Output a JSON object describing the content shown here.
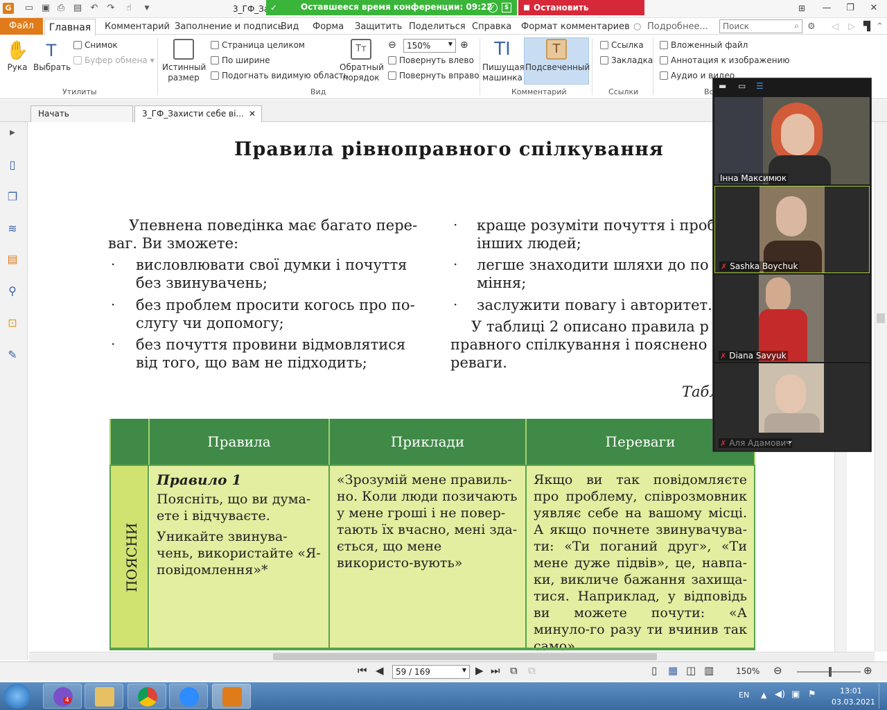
{
  "titlebar": {
    "doc_title": "3_ГФ_За",
    "conference_time": "Оставшееся время конференции: 09:22",
    "stop_demo": "Остановить демонстрацию"
  },
  "menu": {
    "file": "Файл",
    "home": "Главная",
    "items": [
      "Комментарий",
      "Заполнение и подпись",
      "Вид",
      "Форма",
      "Защитить",
      "Поделиться",
      "Справка",
      "Формат комментариев"
    ],
    "details": "Подробнее...",
    "search_placeholder": "Поиск"
  },
  "ribbon": {
    "hand": "Рука",
    "select": "Выбрать",
    "snapshot": "Снимок",
    "clipboard": "Буфер обмена",
    "group_utilities": "Утилиты",
    "actual_size": [
      "Истинный",
      "размер"
    ],
    "full_page": "Страница целиком",
    "fit_width": "По ширине",
    "fit_visible": "Подогнать видимую область",
    "reverse_order": [
      "Обратный",
      "порядок"
    ],
    "zoom": "150%",
    "rotate_left": "Повернуть влево",
    "rotate_right": "Повернуть вправо",
    "group_view": "Вид",
    "typewriter": [
      "Пишущая",
      "машинка"
    ],
    "highlighted": "Подсвеченный",
    "group_comment": "Комментарий",
    "link": "Ссылка",
    "bookmark": "Закладка",
    "group_links": "Ссылки",
    "embedded_file": "Вложенный файл",
    "image_annotation": "Аннотация к изображению",
    "audio_video": "Аудио и видео",
    "group_truncated": "Вс"
  },
  "tabs": {
    "start": "Начать",
    "doc": "3_ГФ_Захисти себе ві..."
  },
  "page": {
    "title": "Правила  рівноправного  спілкування",
    "left_col": {
      "intro1": "Упевнена поведінка має багато пере-",
      "intro2": "ваг. Ви зможете:",
      "b1a": "висловлювати свої думки і почуття",
      "b1b": "без звинувачень;",
      "b2a": "без проблем просити когось про по-",
      "b2b": "слугу чи допомогу;",
      "b3a": "без почуття провини відмовлятися",
      "b3b": "від того, що вам не підходить;"
    },
    "right_col": {
      "b1a": "краще розуміти почуття і проб",
      "b1b": "інших людей;",
      "b2a": "легше знаходити шляхи до по",
      "b2b": "міння;",
      "b3": "заслужити повагу і авторитет.",
      "p1": "У  таблиці  2  описано  правила  р",
      "p2": "правного  спілкування  і  пояснено",
      "p3": "реваги."
    },
    "table_label": "Табл",
    "table": {
      "headers": [
        "Правила",
        "Приклади",
        "Переваги"
      ],
      "side_label": "ПОЯСНИ",
      "rule_title": "Правило 1",
      "rule_text1": "Поясніть, що ви дума-ете і відчуваєте.",
      "rule_text2": "Уникайте звинува-чень, використайте «Я-повідомлення»*",
      "example": "«Зрозумій мене правиль-но. Коли люди позичають у мене гроші і не повер-тають їх вчасно, мені зда-ється, що мене використо-вують»",
      "advantage": "Якщо ви так повідомляєте про проблему, співрозмовник уявляє себе на вашому місці. А якщо почнете звинувачува-ти: «Ти поганий друг», «Ти мене дуже підвів», це, навпа-ки, викличе бажання захища-тися. Наприклад, у відповідь ви можете почути: «А минуло-го разу ти вчинив так само»"
    }
  },
  "video": {
    "participants": [
      "Інна Максимюк",
      "Sashka Boychuk",
      "Diana Savyuk",
      "Аля Адамович"
    ]
  },
  "nav": {
    "page": "59 / 169",
    "zoom": "150%"
  },
  "taskbar": {
    "viber_badge": "4",
    "lang": "EN",
    "time": "13:01",
    "date": "03.03.2021"
  },
  "colors": {
    "accent": "#e07b19",
    "table_header": "#3f8a46",
    "table_body": "#e3eea0",
    "conference": "#3ab53a",
    "stop": "#d7283a"
  }
}
